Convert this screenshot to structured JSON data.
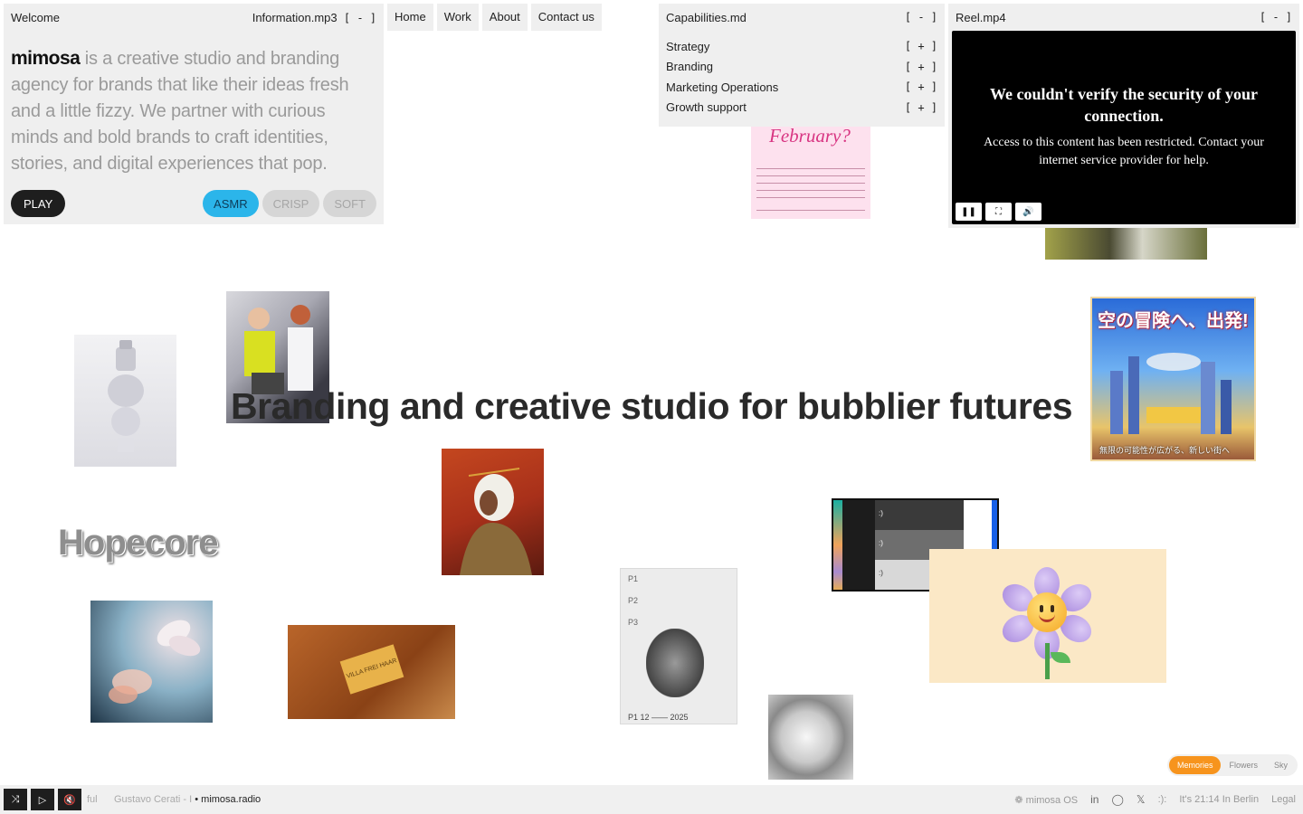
{
  "welcome": {
    "title": "Welcome",
    "track": "Information.mp3",
    "collapse": "[ - ]",
    "brand": "mimosa",
    "intro": " is a creative studio and branding agency for brands that like their ideas fresh and a little fizzy. We partner with curious minds and bold brands to craft identities, stories, and digital experiences that pop.",
    "play_label": "PLAY",
    "moods": [
      "ASMR",
      "CRISP",
      "SOFT"
    ],
    "active_mood": "ASMR"
  },
  "nav": [
    "Home",
    "Work",
    "About",
    "Contact us"
  ],
  "capabilities": {
    "title": "Capabilities.md",
    "collapse": "[ - ]",
    "items": [
      {
        "label": "Strategy",
        "toggle": "[ + ]"
      },
      {
        "label": "Branding",
        "toggle": "[ + ]"
      },
      {
        "label": "Marketing Operations",
        "toggle": "[ + ]"
      },
      {
        "label": "Growth support",
        "toggle": "[ + ]"
      }
    ]
  },
  "reel": {
    "title": "Reel.mp4",
    "collapse": "[ - ]",
    "error_title": "We couldn't verify the security of your connection.",
    "error_body": "Access to this content has been restricted. Contact your internet service provider for help."
  },
  "headline": "Branding and creative studio for bubblier futures",
  "collage": {
    "poster_title": "February?",
    "hopecore": "Hopecore",
    "anime_title": "空の冒険へ、出発!",
    "anime_sub": "無限の可能性が広がる、新しい街へ",
    "card_text": "VILLA FREI HAAR",
    "doc_lines": [
      "P1",
      "P2",
      "P3",
      "P1   12 —— 2025"
    ]
  },
  "themes": [
    "Memories",
    "Flowers",
    "Sky"
  ],
  "active_theme": "Memories",
  "footer": {
    "ticker_prev": "ful",
    "ticker_track": "Gustavo Cerati - I",
    "ticker_station": "mimosa.radio",
    "os": "mimosa OS",
    "face": ":):",
    "time": "It's 21:14 In Berlin",
    "legal": "Legal"
  }
}
